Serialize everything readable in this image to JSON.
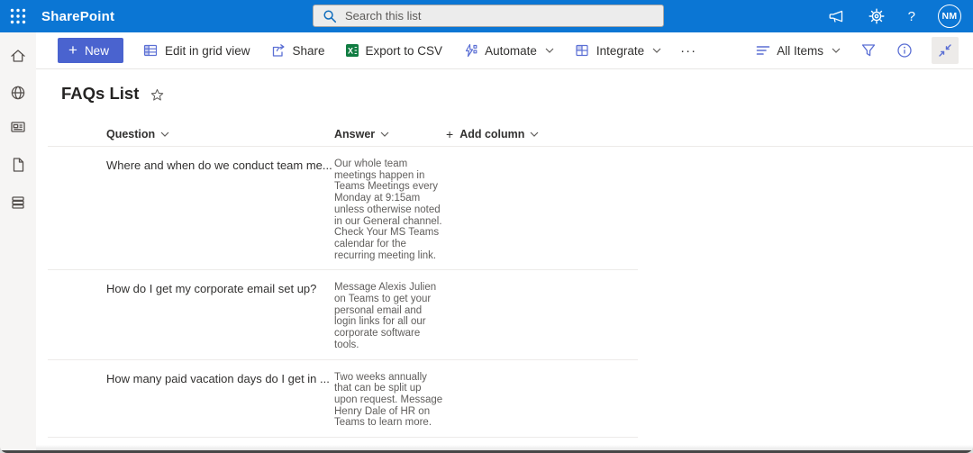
{
  "suite_bar": {
    "app_name": "SharePoint",
    "search_placeholder": "Search this list",
    "avatar_initials": "NM",
    "help_glyph": "?"
  },
  "toolbar": {
    "new_label": "New",
    "edit_grid_label": "Edit in grid view",
    "share_label": "Share",
    "export_csv_label": "Export to CSV",
    "automate_label": "Automate",
    "integrate_label": "Integrate",
    "more_glyph": "···",
    "view_selector_label": "All Items"
  },
  "page": {
    "title": "FAQs List"
  },
  "table": {
    "columns": [
      "Question",
      "Answer"
    ],
    "add_column_label": "Add column",
    "add_column_plus": "+",
    "rows": [
      {
        "question": "Where and when do we conduct team me...",
        "answer": "Our whole team meetings happen in Teams Meetings every Monday at 9:15am unless otherwise noted in our General channel. Check Your MS Teams calendar for the recurring meeting link."
      },
      {
        "question": "How do I get my corporate email set up?",
        "answer": "Message Alexis Julien on Teams to get your personal email and login links for all our corporate software tools."
      },
      {
        "question": "How many paid vacation days do I get in ...",
        "answer": "Two weeks annually that can be split up upon request. Message Henry Dale of HR on Teams to learn more."
      }
    ]
  },
  "icons": {
    "plus": "+",
    "excel_letter": "X",
    "names": [
      "waffle-icon",
      "search-icon",
      "megaphone-icon",
      "gear-icon",
      "help-icon",
      "avatar",
      "home-icon",
      "globe-icon",
      "news-icon",
      "page-icon",
      "library-icon",
      "grid-icon",
      "share-icon",
      "excel-icon",
      "automate-icon",
      "integrate-icon",
      "view-lines-icon",
      "chevron-down-icon",
      "filter-funnel-icon",
      "info-icon",
      "collapse-icon",
      "star-icon"
    ]
  },
  "colors": {
    "suite_bar_blue": "#0b76d4",
    "new_button_blue": "#4a63cf",
    "command_icon_blue": "#5b6fd4",
    "excel_green": "#107c41",
    "text_primary": "#323130",
    "text_secondary": "#605e5c",
    "divider": "#edebe9"
  }
}
